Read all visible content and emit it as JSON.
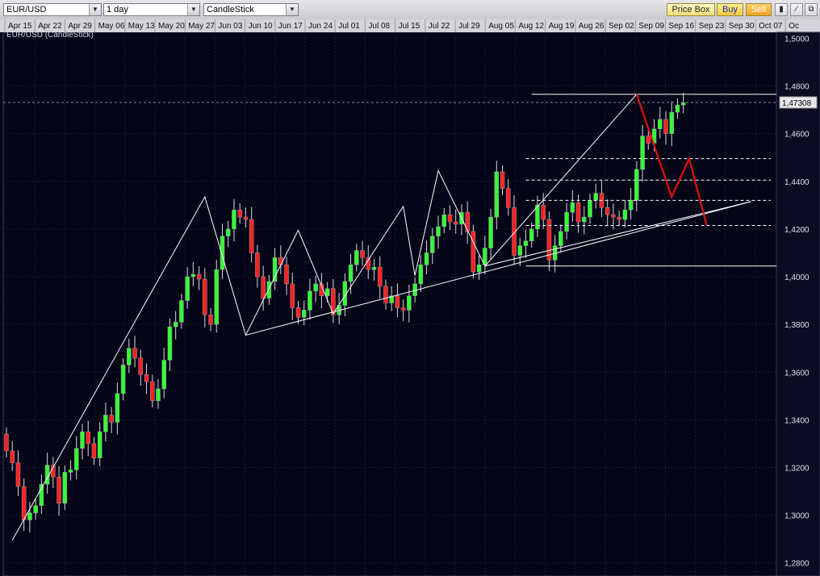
{
  "toolbar": {
    "symbol": "EUR/USD",
    "timeframe": "1 day",
    "chart_type": "CandleStick",
    "price_box_label": "Price Box",
    "buy_label": "Buy",
    "sell_label": "Sell",
    "dropdown_icon": "chevron-down-icon",
    "tool_icons": [
      "bar-chart-icon",
      "draw-line-icon",
      "detach-window-icon"
    ]
  },
  "chart_title": "EUR/USD (CandleStick)",
  "current_price_label": "1,47308",
  "colors": {
    "background": "#050518",
    "up_candle": "#33ff33",
    "down_candle": "#ff2222",
    "drawings": "#ffffff",
    "projection": "#e01010",
    "grid": "#2c2c44"
  },
  "chart_data": {
    "type": "candlestick",
    "symbol": "EUR/USD",
    "timeframe": "1 day",
    "x_ticks": [
      "Apr 15",
      "Apr 22",
      "Apr 29",
      "May 06",
      "May 13",
      "May 20",
      "May 27",
      "Jun 03",
      "Jun 10",
      "Jun 17",
      "Jun 24",
      "Jul 01",
      "Jul 08",
      "Jul 15",
      "Jul 22",
      "Jul 29",
      "Aug 05",
      "Aug 12",
      "Aug 19",
      "Aug 26",
      "Sep 02",
      "Sep 09",
      "Sep 16",
      "Sep 23",
      "Sep 30",
      "Oct 07",
      "Oc"
    ],
    "y_ticks": [
      "1,2800",
      "1,3000",
      "1,3200",
      "1,3400",
      "1,3600",
      "1,3800",
      "1,4000",
      "1,4200",
      "1,4400",
      "1,4600",
      "1,4800",
      "1,5000"
    ],
    "ylim": [
      1.2745,
      1.5025
    ],
    "current_price": 1.47308,
    "closes": [
      1.327,
      1.322,
      1.312,
      1.298,
      1.301,
      1.304,
      1.313,
      1.321,
      1.316,
      1.305,
      1.318,
      1.319,
      1.328,
      1.335,
      1.33,
      1.324,
      1.335,
      1.342,
      1.339,
      1.351,
      1.363,
      1.37,
      1.366,
      1.359,
      1.356,
      1.348,
      1.353,
      1.365,
      1.379,
      1.381,
      1.39,
      1.4,
      1.401,
      1.399,
      1.384,
      1.38,
      1.403,
      1.417,
      1.42,
      1.428,
      1.425,
      1.424,
      1.41,
      1.4,
      1.391,
      1.398,
      1.408,
      1.405,
      1.397,
      1.387,
      1.383,
      1.386,
      1.394,
      1.397,
      1.392,
      1.395,
      1.384,
      1.388,
      1.398,
      1.405,
      1.411,
      1.408,
      1.403,
      1.404,
      1.396,
      1.389,
      1.392,
      1.387,
      1.386,
      1.392,
      1.397,
      1.405,
      1.41,
      1.417,
      1.421,
      1.426,
      1.423,
      1.422,
      1.427,
      1.419,
      1.402,
      1.405,
      1.412,
      1.425,
      1.444,
      1.437,
      1.429,
      1.409,
      1.413,
      1.415,
      1.42,
      1.43,
      1.424,
      1.407,
      1.413,
      1.419,
      1.427,
      1.431,
      1.423,
      1.425,
      1.432,
      1.435,
      1.429,
      1.426,
      1.425,
      1.424,
      1.428,
      1.432,
      1.445,
      1.459,
      1.456,
      1.462,
      1.466,
      1.46,
      1.469,
      1.472,
      1.473
    ],
    "annotations": {
      "horizontal_lines": [
        1.4765,
        1.4045
      ],
      "dashed_levels": [
        1.4495,
        1.4405,
        1.432,
        1.4215
      ],
      "zigzag": [
        [
          1,
          1.2895
        ],
        [
          34,
          1.4335
        ],
        [
          41,
          1.3755
        ],
        [
          50,
          1.4195
        ],
        [
          56,
          1.3845
        ],
        [
          68,
          1.4295
        ],
        [
          70,
          1.4005
        ],
        [
          74,
          1.4445
        ],
        [
          82,
          1.4045
        ],
        [
          108,
          1.4765
        ]
      ],
      "trendlines": [
        [
          [
            41,
            1.3755
          ],
          [
            120,
            1.4315
          ]
        ],
        [
          [
            82,
            1.4045
          ],
          [
            120,
            1.4315
          ]
        ]
      ],
      "projection": [
        [
          108,
          1.4765
        ],
        [
          114,
          1.4335
        ],
        [
          117,
          1.4495
        ],
        [
          120,
          1.4215
        ]
      ]
    }
  }
}
